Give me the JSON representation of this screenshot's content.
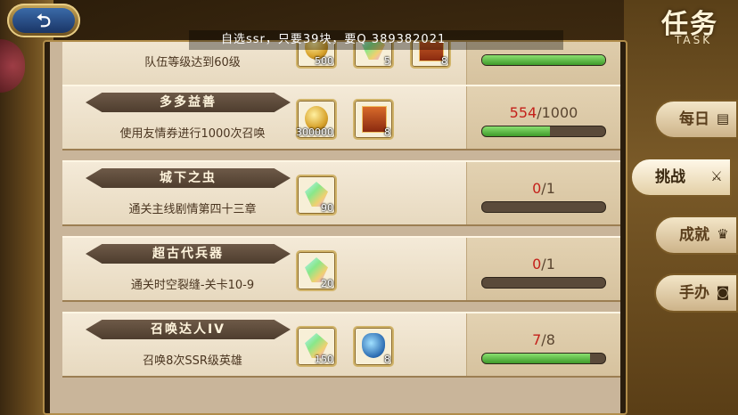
{
  "header": {
    "back_label": "⮌",
    "marquee": "自选ssr，只要39块，要Q 389382021",
    "title_cn": "任务",
    "title_en": "TASK"
  },
  "tabs": [
    {
      "label": "每日",
      "icon": "scroll-icon",
      "active": false
    },
    {
      "label": "挑战",
      "icon": "crossed-swords-icon",
      "active": true
    },
    {
      "label": "成就",
      "icon": "trophy-icon",
      "active": false
    },
    {
      "label": "手办",
      "icon": "figure-icon",
      "active": false
    }
  ],
  "tasks": [
    {
      "title": "",
      "desc": "队伍等级达到60级",
      "rewards": [
        {
          "icon": "coin-icon",
          "count": "500"
        },
        {
          "icon": "gem-icon",
          "count": "5"
        },
        {
          "icon": "ticket-icon",
          "count": "8"
        }
      ],
      "progress_cur": "",
      "progress_total": "",
      "fraction": 1.0
    },
    {
      "title": "多多益善",
      "desc": "使用友情券进行1000次召唤",
      "rewards": [
        {
          "icon": "coin-icon",
          "count": "300000"
        },
        {
          "icon": "ticket-icon",
          "count": "8"
        }
      ],
      "progress_cur": "554",
      "progress_total": "/1000",
      "fraction": 0.554
    },
    {
      "title": "城下之虫",
      "desc": "通关主线剧情第四十三章",
      "rewards": [
        {
          "icon": "gem-icon",
          "count": "90"
        }
      ],
      "progress_cur": "0",
      "progress_total": "/1",
      "fraction": 0
    },
    {
      "title": "超古代兵器",
      "desc": "通关时空裂缝-关卡10-9",
      "rewards": [
        {
          "icon": "gem-icon",
          "count": "20"
        }
      ],
      "progress_cur": "0",
      "progress_total": "/1",
      "fraction": 0
    },
    {
      "title": "召唤达人IV",
      "desc": "召唤8次SSR级英雄",
      "rewards": [
        {
          "icon": "gem-icon",
          "count": "150"
        },
        {
          "icon": "potion-icon",
          "count": "8"
        }
      ],
      "progress_cur": "7",
      "progress_total": "/8",
      "fraction": 0.875
    }
  ]
}
